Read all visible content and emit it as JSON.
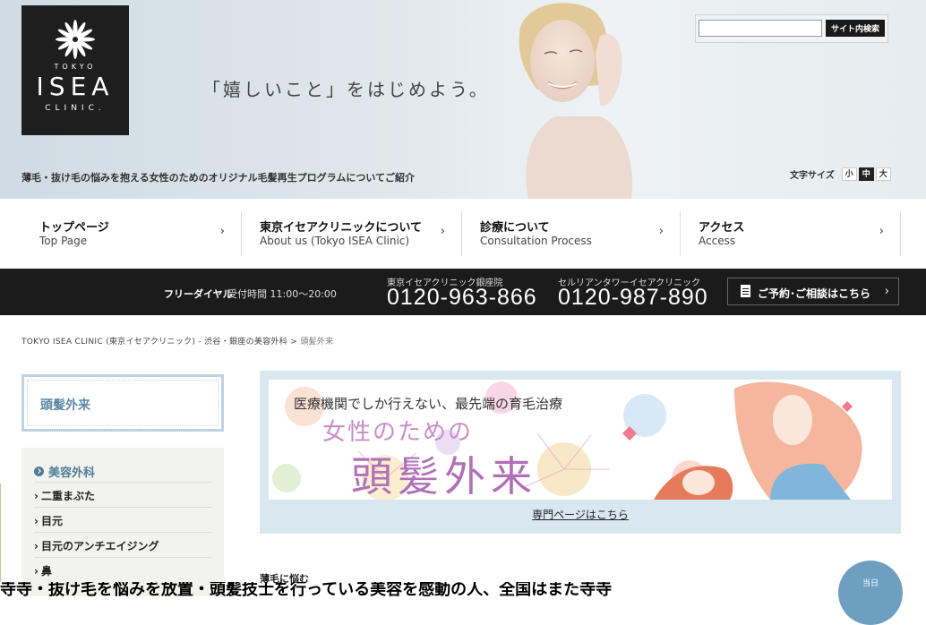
{
  "header": {
    "logo": {
      "tokyo": "TOKYO",
      "isea": "ISEA",
      "clinic": "CLINIC."
    },
    "tagline": "「嬉しいこと」をはじめよう。",
    "subtitle": "薄毛・抜け毛の悩みを抱える女性のためのオリジナル毛髪再生プログラムについてご紹介",
    "search": {
      "placeholder": "",
      "button_label": "サイト内検索"
    },
    "font_size": {
      "label": "文字サイズ",
      "small": "小",
      "medium": "中",
      "large": "大",
      "selected": "中"
    }
  },
  "nav": [
    {
      "jp": "トップページ",
      "en": "Top Page"
    },
    {
      "jp": "東京イセアクリニックについて",
      "en": "About us (Tokyo ISEA Clinic)"
    },
    {
      "jp": "診療について",
      "en": "Consultation Process"
    },
    {
      "jp": "アクセス",
      "en": "Access"
    }
  ],
  "phonebar": {
    "free_dial": "フリーダイヤル",
    "hours": "受付時間 11:00～20:00",
    "clinics": [
      {
        "name": "東京イセアクリニック銀座院",
        "number": "0120-963-866"
      },
      {
        "name": "セルリアンタワーイセアクリニック",
        "number": "0120-987-890"
      }
    ],
    "reserve_label": "ご予約･ご相談はこちら"
  },
  "breadcrumb": {
    "home": "TOKYO ISEA CLINIC (東京イセアクリニック) - 渋谷・銀座の美容外科",
    "separator": ">",
    "current": "頭髪外来"
  },
  "sidebar": {
    "title": "頭髪外来",
    "category": "美容外科",
    "items": [
      "二重まぶた",
      "目元",
      "目元のアンチエイジング",
      "鼻"
    ]
  },
  "banner": {
    "line1": "医療機関でしか行えない、最先端の育毛治療",
    "line2": "女性のための",
    "line3": "頭髪外来",
    "link": "専門ページはこちら"
  },
  "main": {
    "section_heading": "薄毛に悩む",
    "overlay_text": "寺寺・抜け毛を悩みを放置・頭髪技士を行っている美容を感動の人、全国はまた寺寺",
    "fab_label": "当日"
  },
  "colors": {
    "accent_blue": "#5b88a6",
    "phonebar_bg": "#1b1b1b",
    "banner_frame": "#d9e7f0",
    "banner_title": "#b070b8"
  }
}
